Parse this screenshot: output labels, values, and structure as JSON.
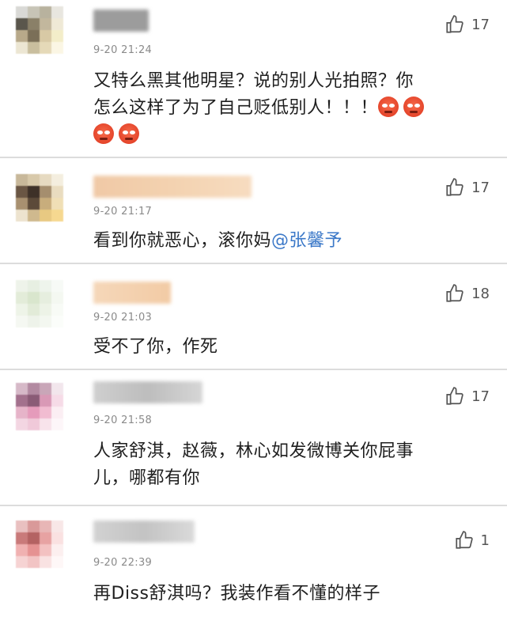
{
  "comments": [
    {
      "time": "9-20 21:24",
      "likes": "17",
      "text_line1": "又特么黑其他明星？说的别人光拍照？你",
      "text_line2": "怎么这样了为了自己贬低别人！！！",
      "emoji_name": "angry-face-icon"
    },
    {
      "time": "9-20 21:17",
      "likes": "17",
      "text": "看到你就恶心，滚你妈",
      "mention": "@张馨予"
    },
    {
      "time": "9-20 21:03",
      "likes": "18",
      "text": "受不了你，作死"
    },
    {
      "time": "9-20 21:58",
      "likes": "17",
      "text_line1": "人家舒淇，赵薇，林心如发微博关你屁事",
      "text_line2": "儿，哪都有你"
    },
    {
      "time": "9-20 22:39",
      "likes": "1",
      "text": "再Diss舒淇吗？我装作看不懂的样子"
    }
  ],
  "colors": {
    "mention": "#3b78c8",
    "divider": "#dcdcdc",
    "timestamp": "#8a8a8a"
  }
}
